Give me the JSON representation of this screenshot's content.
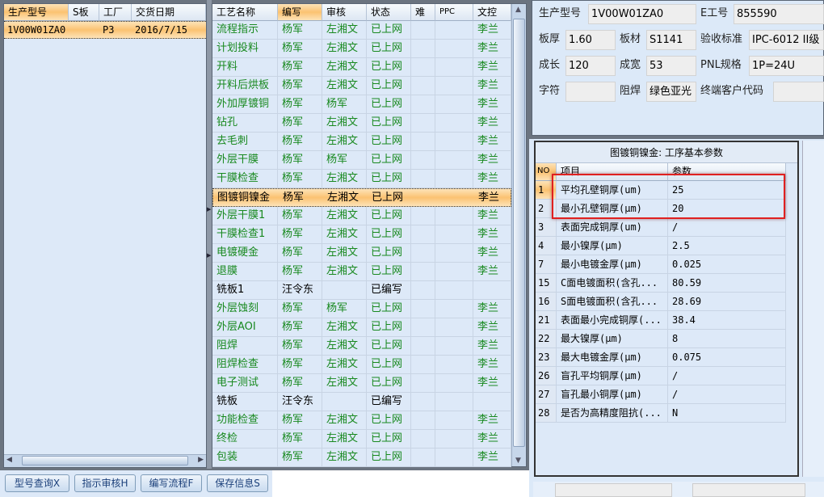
{
  "left_grid": {
    "columns": [
      "生产型号",
      "S板",
      "工厂",
      "交货日期"
    ],
    "rows": [
      {
        "model": "1V00W01ZA0",
        "s": "",
        "factory": "P3",
        "date": "2016/7/15"
      }
    ]
  },
  "buttons": [
    {
      "label": "型号查询X"
    },
    {
      "label": "指示审核H"
    },
    {
      "label": "编写流程F"
    },
    {
      "label": "保存信息S"
    }
  ],
  "process_grid": {
    "columns": [
      "工艺名称",
      "编写",
      "审核",
      "状态",
      "难",
      "PPC",
      "文控"
    ],
    "selected_index": 9,
    "rows": [
      [
        "流程指示",
        "杨军",
        "左湘文",
        "已上网",
        "",
        "",
        "李兰"
      ],
      [
        "计划投料",
        "杨军",
        "左湘文",
        "已上网",
        "",
        "",
        "李兰"
      ],
      [
        "开料",
        "杨军",
        "左湘文",
        "已上网",
        "",
        "",
        "李兰"
      ],
      [
        "开料后烘板",
        "杨军",
        "左湘文",
        "已上网",
        "",
        "",
        "李兰"
      ],
      [
        "外加厚镀铜",
        "杨军",
        "杨军",
        "已上网",
        "",
        "",
        "李兰"
      ],
      [
        "钻孔",
        "杨军",
        "左湘文",
        "已上网",
        "",
        "",
        "李兰"
      ],
      [
        "去毛刺",
        "杨军",
        "左湘文",
        "已上网",
        "",
        "",
        "李兰"
      ],
      [
        "外层干膜",
        "杨军",
        "杨军",
        "已上网",
        "",
        "",
        "李兰"
      ],
      [
        "干膜检查",
        "杨军",
        "左湘文",
        "已上网",
        "",
        "",
        "李兰"
      ],
      [
        "图镀铜镍金",
        "杨军",
        "左湘文",
        "已上网",
        "",
        "",
        "李兰"
      ],
      [
        "外层干膜1",
        "杨军",
        "左湘文",
        "已上网",
        "",
        "",
        "李兰"
      ],
      [
        "干膜检查1",
        "杨军",
        "左湘文",
        "已上网",
        "",
        "",
        "李兰"
      ],
      [
        "电镀硬金",
        "杨军",
        "左湘文",
        "已上网",
        "",
        "",
        "李兰"
      ],
      [
        "退膜",
        "杨军",
        "左湘文",
        "已上网",
        "",
        "",
        "李兰"
      ],
      [
        "铣板1",
        "汪令东",
        "",
        "已编写",
        "",
        "",
        ""
      ],
      [
        "外层蚀刻",
        "杨军",
        "杨军",
        "已上网",
        "",
        "",
        "李兰"
      ],
      [
        "外层AOI",
        "杨军",
        "左湘文",
        "已上网",
        "",
        "",
        "李兰"
      ],
      [
        "阻焊",
        "杨军",
        "左湘文",
        "已上网",
        "",
        "",
        "李兰"
      ],
      [
        "阻焊检查",
        "杨军",
        "左湘文",
        "已上网",
        "",
        "",
        "李兰"
      ],
      [
        "电子测试",
        "杨军",
        "左湘文",
        "已上网",
        "",
        "",
        "李兰"
      ],
      [
        "铣板",
        "汪令东",
        "",
        "已编写",
        "",
        "",
        ""
      ],
      [
        "功能检查",
        "杨军",
        "左湘文",
        "已上网",
        "",
        "",
        "李兰"
      ],
      [
        "终检",
        "杨军",
        "左湘文",
        "已上网",
        "",
        "",
        "李兰"
      ],
      [
        "包装",
        "杨军",
        "左湘文",
        "已上网",
        "",
        "",
        "李兰"
      ]
    ]
  },
  "info": {
    "model_label": "生产型号",
    "model": "1V00W01ZA0",
    "eno_label": "E工号",
    "eno": "855590",
    "thickness_label": "板厚",
    "thickness": "1.60",
    "material_label": "板材",
    "material": "S1141",
    "standard_label": "验收标准",
    "standard": "IPC-6012 II级",
    "length_label": "成长",
    "length": "120",
    "width_label": "成宽",
    "width": "53",
    "pnl_label": "PNL规格",
    "pnl": "1P=24U",
    "char_label": "字符",
    "char": "",
    "mask_label": "阻焊",
    "mask": "绿色亚光",
    "customer_label": "终端客户代码",
    "customer": ""
  },
  "params": {
    "title": "图镀铜镍金: 工序基本参数",
    "columns": [
      "NO",
      "项目",
      "参数"
    ],
    "rows": [
      [
        "1",
        "平均孔壁铜厚(um)",
        "25"
      ],
      [
        "2",
        "最小孔壁铜厚(μm)",
        "20"
      ],
      [
        "3",
        "表面完成铜厚(um)",
        "/"
      ],
      [
        "4",
        "最小镍厚(μm)",
        "2.5"
      ],
      [
        "7",
        "最小电镀金厚(μm)",
        "0.025"
      ],
      [
        "15",
        "C面电镀面积(含孔...",
        "80.59"
      ],
      [
        "16",
        "S面电镀面积(含孔...",
        "28.69"
      ],
      [
        "21",
        "表面最小完成铜厚(...",
        "38.4"
      ],
      [
        "22",
        "最大镍厚(μm)",
        "8"
      ],
      [
        "23",
        "最大电镀金厚(μm)",
        "0.075"
      ],
      [
        "26",
        "盲孔平均铜厚(μm)",
        "/"
      ],
      [
        "27",
        "盲孔最小铜厚(μm)",
        "/"
      ],
      [
        "28",
        "是否为高精度阻抗(...",
        "N"
      ]
    ]
  },
  "colors": {
    "approved_text": "#18891f",
    "selected_row": "#fbc271",
    "highlight_box": "#e02020",
    "panel_bg": "#dce9f8"
  }
}
